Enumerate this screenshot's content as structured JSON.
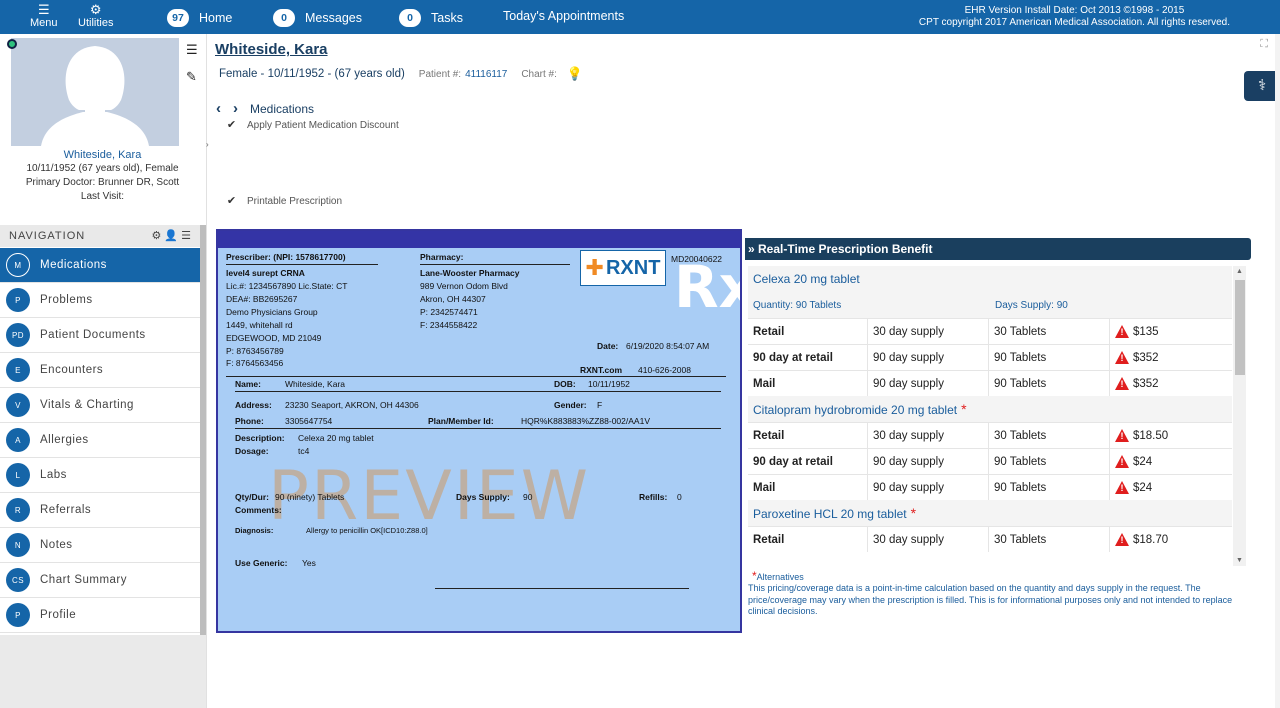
{
  "topbar": {
    "menu_label": "Menu",
    "utilities_label": "Utilities",
    "home_count": "97",
    "home_label": "Home",
    "messages_count": "0",
    "messages_label": "Messages",
    "tasks_count": "0",
    "tasks_label": "Tasks",
    "appointments_label": "Today's Appointments",
    "version_line": "EHR Version Install Date: Oct 2013 ©1998 - 2015",
    "copyright_line": "CPT copyright 2017 American Medical Association. All rights reserved."
  },
  "patient": {
    "name": "Whiteside, Kara",
    "dob_line": "10/11/1952 (67 years old), Female",
    "primary_doctor": "Primary Doctor:  Brunner DR, Scott",
    "last_visit": "Last Visit:",
    "header_name": "Whiteside, Kara",
    "demographics": "Female - 10/11/1952 - (67 years old)",
    "patient_num_label": "Patient #:",
    "patient_num": "41116117",
    "chart_num_label": "Chart #:"
  },
  "navigation": {
    "title": "NAVIGATION",
    "items": [
      {
        "abbr": "M",
        "label": "Medications"
      },
      {
        "abbr": "P",
        "label": "Problems"
      },
      {
        "abbr": "PD",
        "label": "Patient Documents"
      },
      {
        "abbr": "E",
        "label": "Encounters"
      },
      {
        "abbr": "V",
        "label": "Vitals & Charting"
      },
      {
        "abbr": "A",
        "label": "Allergies"
      },
      {
        "abbr": "L",
        "label": "Labs"
      },
      {
        "abbr": "R",
        "label": "Referrals"
      },
      {
        "abbr": "N",
        "label": "Notes"
      },
      {
        "abbr": "CS",
        "label": "Chart Summary"
      },
      {
        "abbr": "P",
        "label": "Profile"
      }
    ]
  },
  "medications": {
    "title": "Medications",
    "apply_discount": "Apply Patient Medication Discount",
    "printable_rx": "Printable Prescription"
  },
  "rx": {
    "prescriber_label": "Prescriber: (NPI: 1578617700)",
    "prescriber_name": "level4 surept CRNA",
    "lic": "Lic.#: 1234567890 Lic.State: CT",
    "dea": "DEA#: BB2695267",
    "group": "Demo Physicians Group",
    "address1": "1449, whitehall rd",
    "address2": "EDGEWOOD,  MD 21049",
    "phone": "P: 8763456789",
    "fax": "F: 8764563456",
    "pharmacy_label": "Pharmacy:",
    "pharmacy_name": "Lane-Wooster Pharmacy",
    "pharmacy_addr1": "989 Vernon Odom Blvd",
    "pharmacy_addr2": "Akron,  OH 44307",
    "pharmacy_phone": "P: 2342574471",
    "pharmacy_fax": "F: 2344558422",
    "logo_text": "RXNT",
    "md_num": "MD20040622",
    "rx_symbol": "Rx",
    "date_label": "Date:",
    "date_value": "6/19/2020 8:54:07 AM",
    "rxnt_site": "RXNT.com",
    "rxnt_phone": "410-626-2008",
    "name_label": "Name:",
    "name_value": "Whiteside, Kara",
    "dob_label": "DOB:",
    "dob_value": "10/11/1952",
    "address_label": "Address:",
    "address_value": "23230 Seaport, AKRON, OH 44306",
    "gender_label": "Gender:",
    "gender_value": "F",
    "phone_label": "Phone:",
    "phone_value": "3305647754",
    "plan_label": "Plan/Member Id:",
    "plan_value": "HQR%K883883%ZZ88-002/AA1V",
    "desc_label": "Description:",
    "desc_value": "Celexa 20 mg tablet",
    "dosage_label": "Dosage:",
    "dosage_value": "tc4",
    "watermark": "PREVIEW",
    "qty_label": "Qty/Dur:",
    "qty_value": "90 (ninety) Tablets",
    "days_label": "Days Supply:",
    "days_value": "90",
    "refills_label": "Refills:",
    "refills_value": "0",
    "comments_label": "Comments:",
    "diag_label": "Diagnosis:",
    "diag_value": "Allergy to penicillin OK[ICD10:Z88.0]",
    "generic_label": "Use Generic:",
    "generic_value": "Yes"
  },
  "rtpb": {
    "title": "» Real-Time Prescription Benefit",
    "drugs": [
      {
        "name": "Celexa 20 mg tablet",
        "quantity": "Quantity: 90 Tablets",
        "days": "Days Supply: 90",
        "rows": [
          {
            "type": "Retail",
            "supply": "30 day supply",
            "qty": "30 Tablets",
            "price": "$135"
          },
          {
            "type": "90 day at retail",
            "supply": "90 day supply",
            "qty": "90 Tablets",
            "price": "$352"
          },
          {
            "type": "Mail",
            "supply": "90 day supply",
            "qty": "90 Tablets",
            "price": "$352"
          }
        ]
      },
      {
        "name": "Citalopram hydrobromide 20 mg tablet",
        "rows": [
          {
            "type": "Retail",
            "supply": "30 day supply",
            "qty": "30 Tablets",
            "price": "$18.50"
          },
          {
            "type": "90 day at retail",
            "supply": "90 day supply",
            "qty": "90 Tablets",
            "price": "$24"
          },
          {
            "type": "Mail",
            "supply": "90 day supply",
            "qty": "90 Tablets",
            "price": "$24"
          }
        ]
      },
      {
        "name": "Paroxetine HCL 20 mg tablet",
        "rows": [
          {
            "type": "Retail",
            "supply": "30 day supply",
            "qty": "30 Tablets",
            "price": "$18.70"
          }
        ]
      }
    ],
    "alternatives_label": "Alternatives",
    "disclaimer": "This pricing/coverage data is a point-in-time calculation based on the quantity and days supply in the request. The price/coverage may vary when the prescription is filled. This is for informational purposes only and not intended to replace clinical decisions."
  },
  "colors": {
    "primary": "#1565a8",
    "navy": "#1a3f5e",
    "rx_bg": "#a9cdf5",
    "warning": "#e01e1e",
    "bulb": "#f0922e"
  }
}
